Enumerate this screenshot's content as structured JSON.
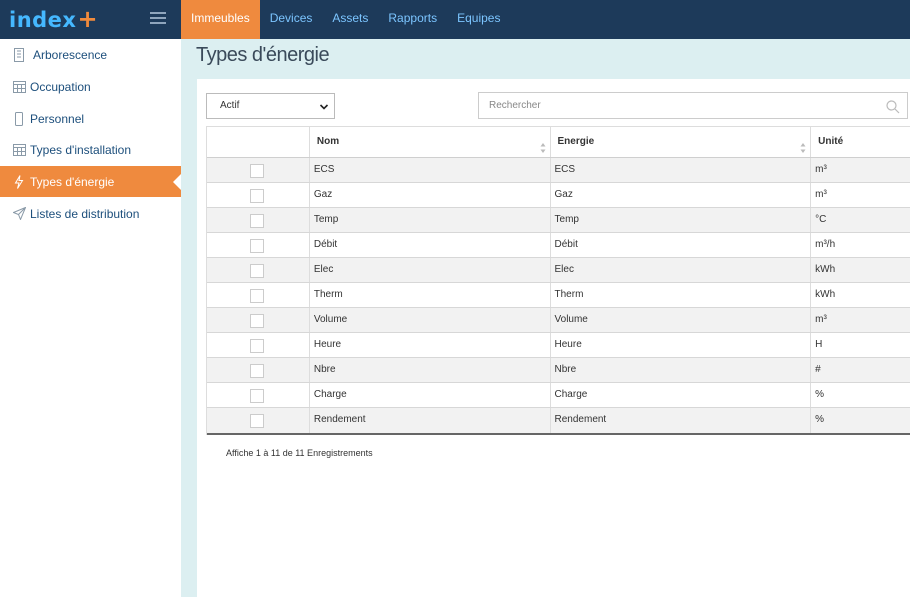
{
  "logo": {
    "text": "index",
    "plus": "+"
  },
  "topnav": [
    "Immeubles",
    "Devices",
    "Assets",
    "Rapports",
    "Equipes"
  ],
  "sidebar": [
    {
      "label": "Arborescence",
      "icon": "building-icon"
    },
    {
      "label": "Occupation",
      "icon": "calendar-icon"
    },
    {
      "label": "Personnel",
      "icon": "phone-icon"
    },
    {
      "label": "Types d'installation",
      "icon": "calendar-icon"
    },
    {
      "label": "Types d'énergie",
      "icon": "lightning-icon",
      "active": true
    },
    {
      "label": "Listes de distribution",
      "icon": "send-icon"
    }
  ],
  "page": {
    "title": "Types d'énergie"
  },
  "filter": {
    "value": "Actif"
  },
  "search": {
    "placeholder": "Rechercher"
  },
  "table": {
    "headers": [
      "",
      "Nom",
      "Energie",
      "Unité"
    ],
    "rows": [
      [
        "ECS",
        "ECS",
        "m³"
      ],
      [
        "Gaz",
        "Gaz",
        "m³"
      ],
      [
        "Temp",
        "Temp",
        "°C"
      ],
      [
        "Débit",
        "Débit",
        "m³/h"
      ],
      [
        "Elec",
        "Elec",
        "kWh"
      ],
      [
        "Therm",
        "Therm",
        "kWh"
      ],
      [
        "Volume",
        "Volume",
        "m³"
      ],
      [
        "Heure",
        "Heure",
        "H"
      ],
      [
        "Nbre",
        "Nbre",
        "#"
      ],
      [
        "Charge",
        "Charge",
        "%"
      ],
      [
        "Rendement",
        "Rendement",
        "%"
      ]
    ]
  },
  "info": "Affiche 1 à 11 de 11 Enregistrements",
  "colors": {
    "topbar": "#1d3a5a",
    "accent": "#ef8a3e",
    "link": "#1d4f7c",
    "strip": "#dceff1"
  }
}
